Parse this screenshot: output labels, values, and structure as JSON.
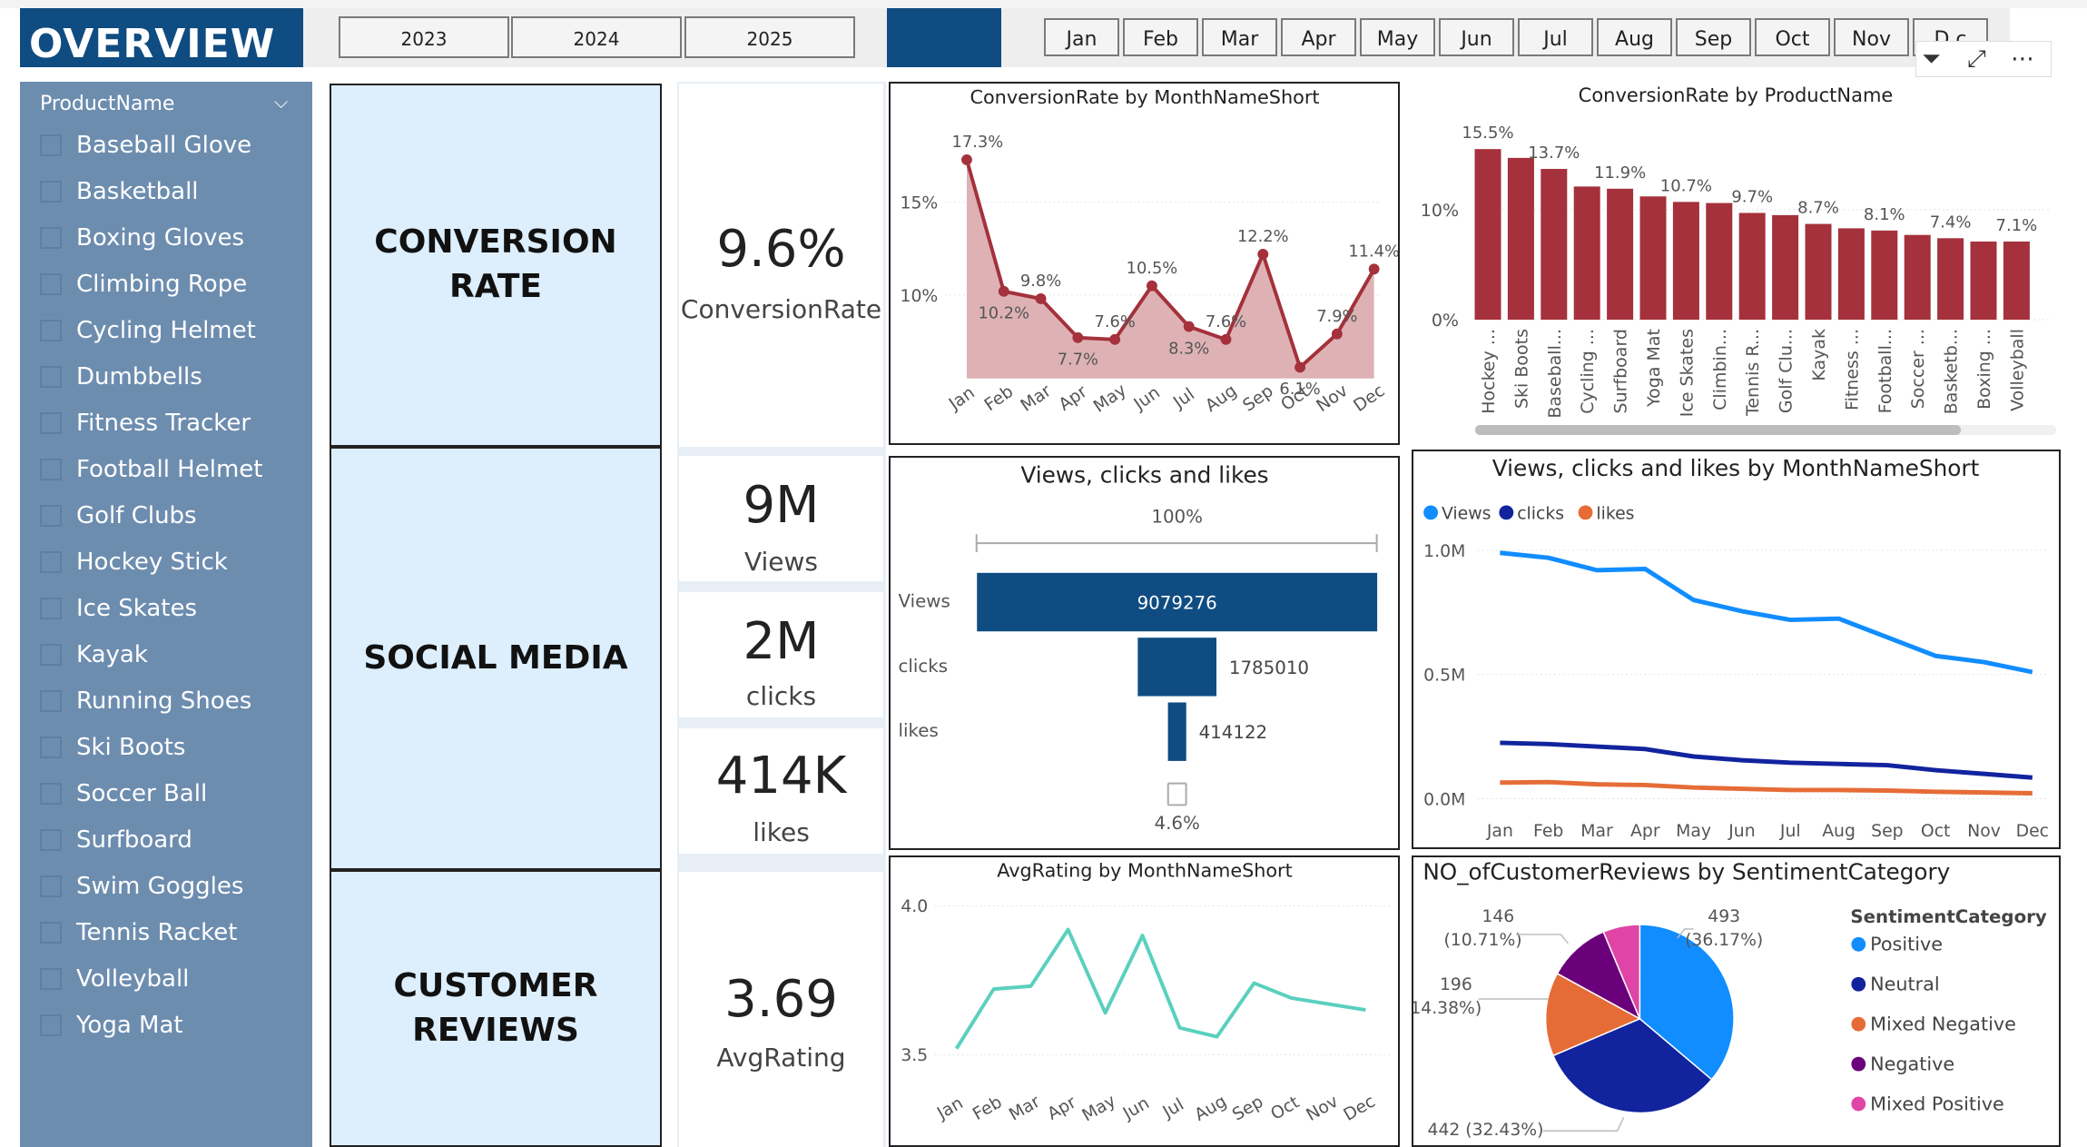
{
  "header": {
    "title": "OVERVIEW",
    "years": [
      "2023",
      "2024",
      "2025"
    ],
    "months": [
      "Jan",
      "Feb",
      "Mar",
      "Apr",
      "May",
      "Jun",
      "Jul",
      "Aug",
      "Sep",
      "Oct",
      "Nov",
      "D c"
    ]
  },
  "visual_header_icons": [
    "filter-icon",
    "focus-mode-icon",
    "more-options-icon"
  ],
  "slicer": {
    "title": "ProductName",
    "items": [
      "Baseball Glove",
      "Basketball",
      "Boxing Gloves",
      "Climbing Rope",
      "Cycling Helmet",
      "Dumbbells",
      "Fitness Tracker",
      "Football Helmet",
      "Golf Clubs",
      "Hockey Stick",
      "Ice Skates",
      "Kayak",
      "Running Shoes",
      "Ski Boots",
      "Soccer Ball",
      "Surfboard",
      "Swim Goggles",
      "Tennis Racket",
      "Volleyball",
      "Yoga Mat"
    ]
  },
  "sections": {
    "conversion": "CONVERSION RATE",
    "social": "SOCIAL MEDIA",
    "reviews_line1": "CUSTOMER",
    "reviews_line2": "REVIEWS"
  },
  "kpis": {
    "conversion": {
      "value": "9.6%",
      "label": "ConversionRate"
    },
    "views": {
      "value": "9M",
      "label": "Views"
    },
    "clicks": {
      "value": "2M",
      "label": "clicks"
    },
    "likes": {
      "value": "414K",
      "label": "likes"
    },
    "rating": {
      "value": "3.69",
      "label": "AvgRating"
    }
  },
  "colors": {
    "brand": "#0f4c81",
    "slicer_bg": "#6d8daf",
    "section_bg": "#ddeefc",
    "conversion_line": "#a4313b",
    "conversion_area": "#d8a5a8",
    "views": "#118dff",
    "clicks": "#12239e",
    "likes": "#e66c37",
    "rating_line": "#5ad0bd",
    "negative": "#6b007b",
    "mixed_positive": "#e044a7"
  },
  "chart_data": [
    {
      "id": "conversion-by-month",
      "type": "area",
      "title": "ConversionRate by MonthNameShort",
      "categories": [
        "Jan",
        "Feb",
        "Mar",
        "Apr",
        "May",
        "Jun",
        "Jul",
        "Aug",
        "Sep",
        "Oct",
        "Nov",
        "Dec"
      ],
      "values": [
        17.3,
        10.2,
        9.8,
        7.7,
        7.6,
        10.5,
        8.3,
        7.6,
        12.2,
        6.1,
        7.9,
        11.4
      ],
      "labels": [
        "17.3%",
        "10.2%",
        "9.8%",
        "7.7%",
        "7.6%",
        "10.5%",
        "8.3%",
        "7.6%",
        "12.2%",
        "6.1%",
        "7.9%",
        "11.4%"
      ],
      "yticks": [
        "10%",
        "15%"
      ],
      "ylim": [
        5.5,
        18.5
      ]
    },
    {
      "id": "conversion-by-product",
      "type": "bar",
      "title": "ConversionRate by ProductName",
      "categories": [
        "Hockey ...",
        "Ski Boots",
        "Baseball...",
        "Cycling ...",
        "Surfboard",
        "Yoga Mat",
        "Ice Skates",
        "Climbin...",
        "Tennis R...",
        "Golf Clu...",
        "Kayak",
        "Fitness ...",
        "Football...",
        "Soccer ...",
        "Basketb...",
        "Boxing ...",
        "Volleyball"
      ],
      "values": [
        15.5,
        14.7,
        13.7,
        12.1,
        11.9,
        11.2,
        10.7,
        10.6,
        9.7,
        9.5,
        8.7,
        8.3,
        8.1,
        7.7,
        7.4,
        7.1,
        7.1
      ],
      "labels": [
        "15.5%",
        "",
        "13.7%",
        "",
        "11.9%",
        "",
        "10.7%",
        "",
        "9.7%",
        "",
        "8.7%",
        "",
        "8.1%",
        "",
        "7.4%",
        "",
        "7.1%"
      ],
      "yticks": [
        "0%",
        "10%"
      ],
      "ylim": [
        0,
        17
      ]
    },
    {
      "id": "funnel",
      "type": "bar",
      "title": "Views, clicks and likes",
      "categories": [
        "Views",
        "clicks",
        "likes"
      ],
      "values": [
        9079276,
        1785010,
        414122
      ],
      "top_pct": "100%",
      "bottom_pct": "4.6%"
    },
    {
      "id": "engagement-by-month",
      "type": "line",
      "title": "Views, clicks and likes by MonthNameShort",
      "categories": [
        "Jan",
        "Feb",
        "Mar",
        "Apr",
        "May",
        "Jun",
        "Jul",
        "Aug",
        "Sep",
        "Oct",
        "Nov",
        "Dec"
      ],
      "series": [
        {
          "name": "Views",
          "values": [
            0.99,
            0.97,
            0.92,
            0.925,
            0.8,
            0.755,
            0.72,
            0.725,
            0.65,
            0.575,
            0.55,
            0.51
          ]
        },
        {
          "name": "clicks",
          "values": [
            0.225,
            0.22,
            0.21,
            0.2,
            0.17,
            0.155,
            0.145,
            0.14,
            0.135,
            0.115,
            0.1,
            0.085
          ]
        },
        {
          "name": "likes",
          "values": [
            0.065,
            0.067,
            0.058,
            0.055,
            0.045,
            0.04,
            0.035,
            0.035,
            0.033,
            0.028,
            0.025,
            0.022
          ]
        }
      ],
      "yticks": [
        "0.0M",
        "0.5M",
        "1.0M"
      ],
      "ylim": [
        0,
        1.0
      ]
    },
    {
      "id": "rating-by-month",
      "type": "line",
      "title": "AvgRating by MonthNameShort",
      "categories": [
        "Jan",
        "Feb",
        "Mar",
        "Apr",
        "May",
        "Jun",
        "Jul",
        "Aug",
        "Sep",
        "Oct",
        "Nov",
        "Dec"
      ],
      "values": [
        3.52,
        3.72,
        3.73,
        3.92,
        3.64,
        3.9,
        3.59,
        3.56,
        3.74,
        3.69,
        3.67,
        3.65
      ],
      "yticks": [
        "3.5",
        "4.0"
      ],
      "ylim": [
        3.5,
        4.0
      ]
    },
    {
      "id": "reviews-by-sentiment",
      "type": "pie",
      "title": "NO_ofCustomerReviews by SentimentCategory",
      "legend_title": "SentimentCategory",
      "slices": [
        {
          "name": "Positive",
          "value": 493,
          "label": "493",
          "pct": "(36.17%)"
        },
        {
          "name": "Neutral",
          "value": 442,
          "label": "442 (32.43%)",
          "pct": ""
        },
        {
          "name": "Mixed Negative",
          "value": 196,
          "label": "196",
          "pct": "(14.38%)"
        },
        {
          "name": "Negative",
          "value": 146,
          "label": "146",
          "pct": "(10.71%)"
        },
        {
          "name": "Mixed Positive",
          "value": 86,
          "label": "",
          "pct": ""
        }
      ]
    }
  ]
}
